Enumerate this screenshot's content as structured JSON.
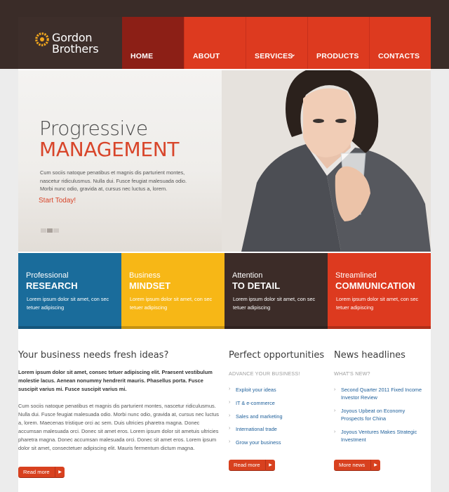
{
  "brand": {
    "line1": "Gordon",
    "line2": "Brothers",
    "accent": "#f2a71d"
  },
  "nav": [
    {
      "label": "HOME",
      "active": true
    },
    {
      "label": "ABOUT"
    },
    {
      "label": "SERVICES",
      "icon": "chevron-down-icon"
    },
    {
      "label": "PRODUCTS"
    },
    {
      "label": "CONTACTS"
    }
  ],
  "hero": {
    "title1": "Progressive",
    "title2": "MANAGEMENT",
    "text": "Cum sociis natoque penatibus et magnis dis parturient montes, nascetur ridiculusmus. Nulla dui. Fusce feugiat malesuada odio. Morbi nunc odio, gravida at, cursus nec luctus a, lorem.",
    "cta": "Start Today!",
    "slides": 3,
    "active_slide": 2
  },
  "features": [
    {
      "small": "Professional",
      "big": "RESEARCH",
      "text": "Lorem ipsum dolor sit amet, con sec tetuer adipiscing",
      "color": "#1a6c9b"
    },
    {
      "small": "Business",
      "big": "MINDSET",
      "text": "Lorem ipsum dolor sit amet, con sec tetuer adipiscing",
      "color": "#f7b716"
    },
    {
      "small": "Attention",
      "big": "TO DETAIL",
      "text": "Lorem ipsum dolor sit amet, con sec tetuer adipiscing",
      "color": "#3c2c28"
    },
    {
      "small": "Streamlined",
      "big": "COMMUNICATION",
      "text": "Lorem ipsum dolor sit amet, con sec tetuer adipiscing",
      "color": "#dd3a1f"
    }
  ],
  "about": {
    "title": "Your business needs fresh ideas?",
    "lead": "Lorem ipsum dolor sit amet, consec tetuer adipiscing elit. Praesent vestibulum molestie lacus. Aenean nonummy hendrerit mauris. Phasellus porta. Fusce suscipit varius mi. Fusce suscipit varius mi.",
    "body": "Cum sociis natoque penatibus et magnis dis parturient montes, nascetur ridiculusmus. Nulla dui. Fusce feugiat malesuada odio. Morbi nunc odio, gravida at, cursus nec luctus a, lorem. Maecenas tristique orci ac sem. Duis ultricies pharetra magna. Donec accumsan malesuada orci. Donec sit amet eros. Lorem ipsum dolor sit ametuis ultricies pharetra magna. Donec accumsan malesuada orci. Donec sit amet eros. Lorem ipsum dolor sit amet, consectetuer adipiscing elit. Mauris fermentum dictum magna.",
    "button": "Read more"
  },
  "opportunities": {
    "title": "Perfect opportunities",
    "subtitle": "ADVANCE YOUR BUSINESS!",
    "items": [
      "Exploit your ideas",
      "IT & e-commerce",
      "Sales and marketing",
      "International trade",
      "Grow your business"
    ],
    "button": "Read more"
  },
  "news": {
    "title": "News headlines",
    "subtitle": "WHAT'S NEW?",
    "items": [
      "Second Quarter 2011 Fixed Income Investor Review",
      "Joyous Upbeat on Economy Prospects for China",
      "Joyous Ventures Makes Strategic Investment"
    ],
    "button": "More news"
  }
}
